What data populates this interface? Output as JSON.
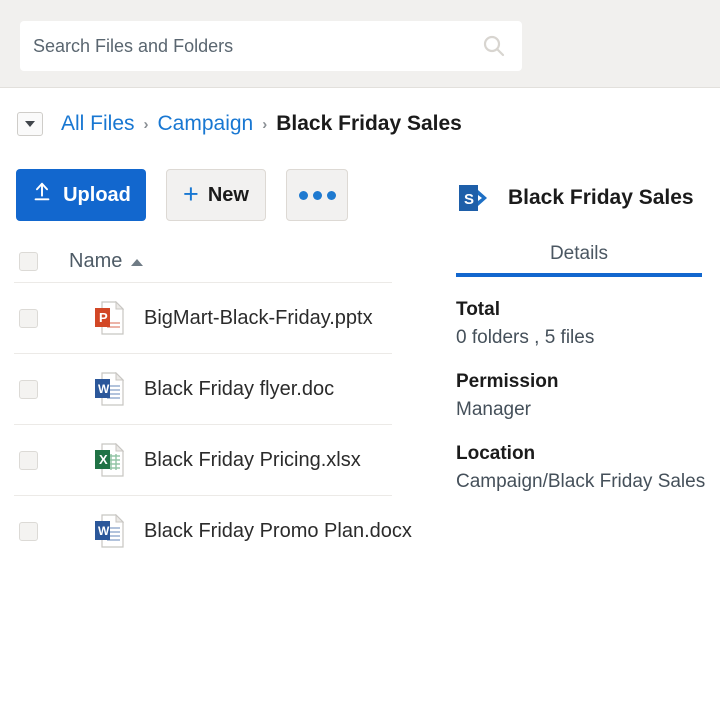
{
  "search": {
    "placeholder": "Search Files and Folders",
    "value": "",
    "icon": "search-icon"
  },
  "breadcrumb": {
    "toggle_icon": "caret-down-icon",
    "separator": "›",
    "items": [
      {
        "label": "All Files",
        "current": false
      },
      {
        "label": "Campaign",
        "current": false
      },
      {
        "label": "Black Friday Sales",
        "current": true
      }
    ]
  },
  "toolbar": {
    "upload_label": "Upload",
    "upload_icon": "upload-arrow-icon",
    "new_label": "New",
    "new_icon": "plus-icon",
    "more_icon": "ellipsis-icon",
    "accent_color": "#1267ce"
  },
  "file_list": {
    "columns": [
      {
        "label": "Name",
        "sort": "ascending"
      }
    ],
    "rows": [
      {
        "name": "BigMart-Black-Friday.pptx",
        "icon": "powerpoint-file-icon",
        "type": "pptx",
        "selected": false
      },
      {
        "name": "Black Friday flyer.doc",
        "icon": "word-file-icon",
        "type": "doc",
        "selected": false
      },
      {
        "name": "Black Friday Pricing.xlsx",
        "icon": "excel-file-icon",
        "type": "xlsx",
        "selected": false
      },
      {
        "name": "Black Friday Promo Plan.docx",
        "icon": "word-file-icon",
        "type": "docx",
        "selected": false
      }
    ]
  },
  "details": {
    "logo_icon": "sharepoint-logo-icon",
    "title": "Black Friday Sales",
    "tabs": [
      {
        "label": "Details",
        "active": true
      }
    ],
    "fields": [
      {
        "label": "Total",
        "value": "0 folders , 5 files"
      },
      {
        "label": "Permission",
        "value": "Manager"
      },
      {
        "label": "Location",
        "value": "Campaign/Black Friday Sales"
      }
    ]
  },
  "colors": {
    "accent_blue": "#1267ce",
    "link_blue": "#1877d2",
    "header_band": "#f1f0ee",
    "word_blue": "#2b579a",
    "excel_green": "#207245",
    "powerpoint_orange": "#d24726"
  }
}
